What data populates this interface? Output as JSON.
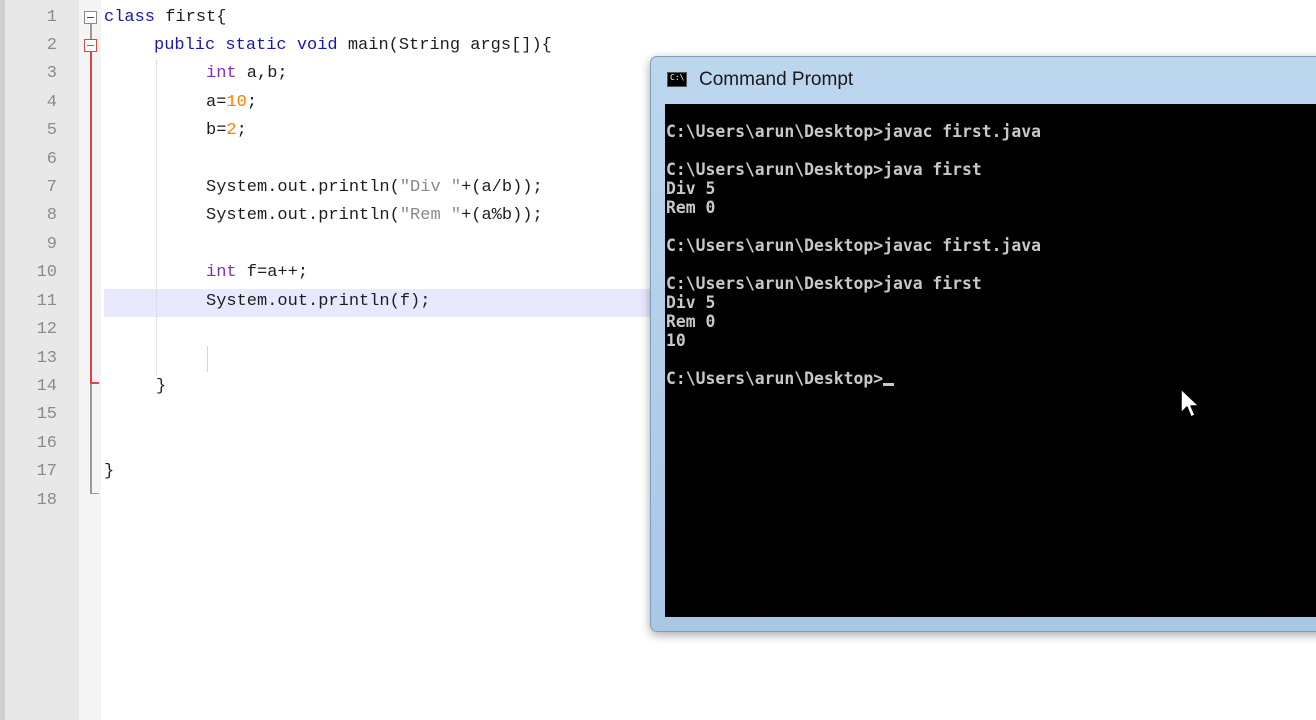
{
  "editor": {
    "line_numbers": [
      "1",
      "2",
      "3",
      "4",
      "5",
      "6",
      "7",
      "8",
      "9",
      "10",
      "11",
      "12",
      "13",
      "14",
      "15",
      "16",
      "17",
      "18"
    ],
    "code": {
      "l1_kw": "class",
      "l1_rest": " first{",
      "l2_kw": "public static void",
      "l2_rest": " main(String args[]){",
      "l3_ty": "int",
      "l3_rest": " a,b;",
      "l4_pre": "a=",
      "l4_num": "10",
      "l4_post": ";",
      "l5_pre": "b=",
      "l5_num": "2",
      "l5_post": ";",
      "l7_pre": "System.out.println(",
      "l7_str": "\"Div \"",
      "l7_post": "+(a/b));",
      "l8_pre": "System.out.println(",
      "l8_str": "\"Rem \"",
      "l8_post": "+(a%b));",
      "l10_ty": "int",
      "l10_rest": " f=a++;",
      "l11": "System.out.println(f);",
      "l14": "}",
      "l17": "}"
    }
  },
  "cmd": {
    "title": "Command Prompt",
    "icon_label": "C:\\",
    "output": "C:\\Users\\arun\\Desktop>javac first.java\n\nC:\\Users\\arun\\Desktop>java first\nDiv 5\nRem 0\n\nC:\\Users\\arun\\Desktop>javac first.java\n\nC:\\Users\\arun\\Desktop>java first\nDiv 5\nRem 0\n10\n\nC:\\Users\\arun\\Desktop>"
  },
  "colors": {
    "keyword": "#1a1aa6",
    "type": "#7b2fbe",
    "number": "#ff8000",
    "string": "#8a8a8a",
    "console_bg": "#000000",
    "console_text": "#c8c8c8"
  }
}
